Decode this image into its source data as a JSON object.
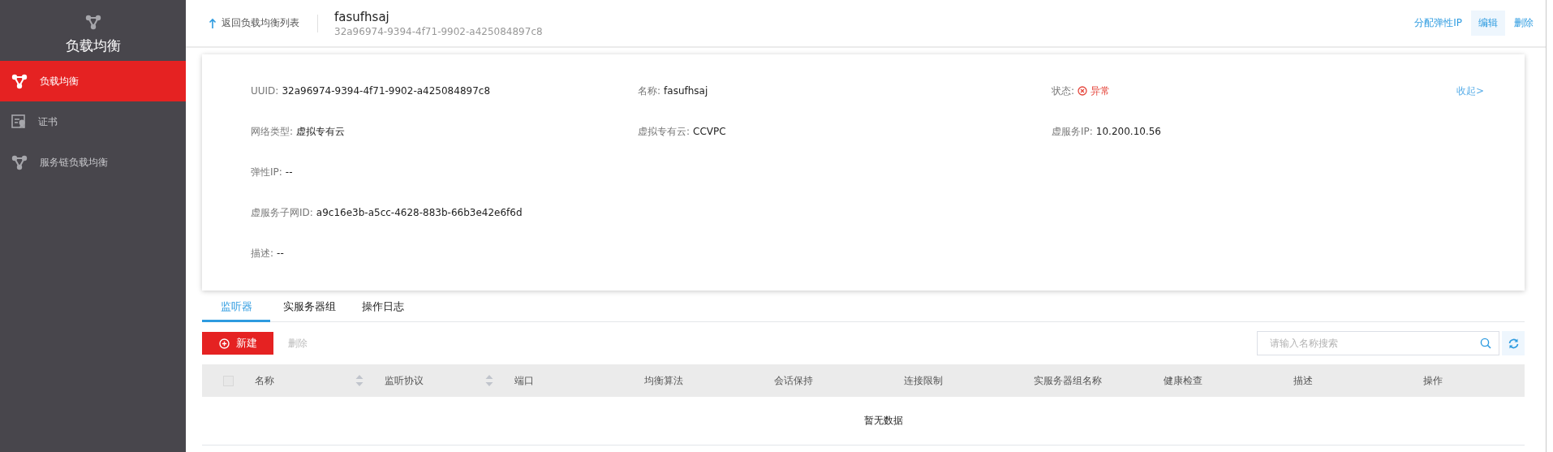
{
  "sidebar": {
    "title": "负载均衡",
    "items": [
      {
        "label": "负载均衡",
        "kind": "nodes",
        "selected": true
      },
      {
        "label": "证书",
        "kind": "certificate",
        "selected": false
      },
      {
        "label": "服务链负载均衡",
        "kind": "nodes",
        "selected": false
      }
    ]
  },
  "header": {
    "back_link": "返回负载均衡列表",
    "name": "fasufhsaj",
    "uuid": "32a96974-9394-4f71-9902-a425084897c8",
    "actions": [
      {
        "label": "分配弹性IP",
        "hovered": false
      },
      {
        "label": "编辑",
        "hovered": true
      },
      {
        "label": "删除",
        "hovered": false
      }
    ]
  },
  "details": {
    "collapse_link": "收起>",
    "rows": [
      [
        {
          "label": "UUID:",
          "value": "32a96974-9394-4f71-9902-a425084897c8",
          "kind": "text"
        },
        {
          "label": "名称:",
          "value": "fasufhsaj",
          "kind": "text"
        },
        {
          "label": "状态:",
          "value": "异常",
          "kind": "error"
        }
      ],
      [
        {
          "label": "网络类型:",
          "value": "虚拟专有云",
          "kind": "text"
        },
        {
          "label": "虚拟专有云:",
          "value": "CCVPC",
          "kind": "text"
        },
        {
          "label": "虚服务IP:",
          "value": "10.200.10.56",
          "kind": "text"
        }
      ],
      [
        {
          "label": "弹性IP:",
          "value": "--",
          "kind": "text"
        }
      ],
      [
        {
          "label": "虚服务子网ID:",
          "value": "a9c16e3b-a5cc-4628-883b-66b3e42e6f6d",
          "kind": "text"
        }
      ],
      [
        {
          "label": "描述:",
          "value": "--",
          "kind": "text"
        }
      ]
    ]
  },
  "tabs": [
    {
      "label": "监听器",
      "selected": true
    },
    {
      "label": "实服务器组",
      "selected": false
    },
    {
      "label": "操作日志",
      "selected": false
    }
  ],
  "toolbar": {
    "create_button": "新建",
    "delete_button": {
      "label": "删除",
      "disabled": true
    },
    "search": {
      "placeholder": "请输入名称搜索"
    }
  },
  "table": {
    "select_all": {
      "checked": false
    },
    "columns": [
      {
        "label": "名称",
        "sortable": true
      },
      {
        "label": "监听协议",
        "sortable": true
      },
      {
        "label": "端口",
        "sortable": false
      },
      {
        "label": "均衡算法",
        "sortable": false
      },
      {
        "label": "会话保持",
        "sortable": false
      },
      {
        "label": "连接限制",
        "sortable": false
      },
      {
        "label": "实服务器组名称",
        "sortable": false
      },
      {
        "label": "健康检查",
        "sortable": false
      },
      {
        "label": "描述",
        "sortable": false
      },
      {
        "label": "操作",
        "sortable": false
      }
    ],
    "empty_text": "暂无数据"
  }
}
